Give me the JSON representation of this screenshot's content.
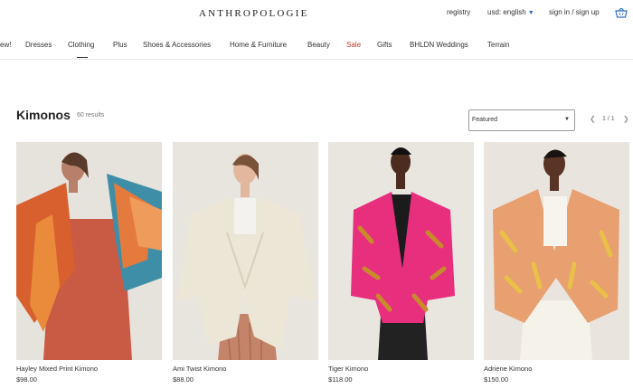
{
  "header": {
    "logo": "ANTHROPOLOGIE",
    "registry": "registry",
    "currency": "usd: english",
    "signin": "sign in / sign up"
  },
  "nav": {
    "items": [
      "ew!",
      "Dresses",
      "Clothing",
      "Plus",
      "Shoes & Accessories",
      "Home & Furniture",
      "Beauty",
      "Sale",
      "Gifts",
      "BHLDN Weddings",
      "Terrain"
    ]
  },
  "listing": {
    "title": "Kimonos",
    "results": "60 results",
    "sort_value": "Featured",
    "page_label": "1 / 1"
  },
  "products": [
    {
      "name": "Hayley Mixed Print Kimono",
      "price": "$98.00"
    },
    {
      "name": "Ami Twist Kimono",
      "price": "$88.00"
    },
    {
      "name": "Tiger Kimono",
      "price": "$118.00"
    },
    {
      "name": "Adriene Kimono",
      "price": "$150.00"
    }
  ],
  "colors": {
    "sale": "#c0392b",
    "currency_caret": "#2f6fc0"
  }
}
